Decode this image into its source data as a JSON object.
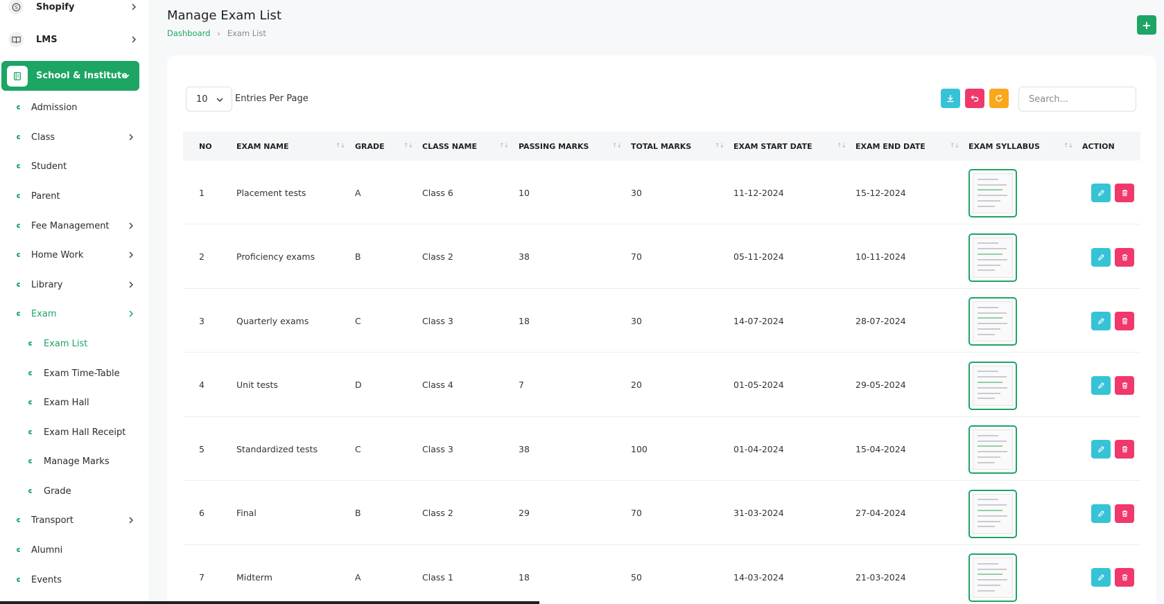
{
  "sidebar": {
    "top_items": [
      {
        "label": "Shopify",
        "icon": "shopify-icon"
      },
      {
        "label": "LMS",
        "icon": "book-icon"
      }
    ],
    "active_item": {
      "label": "School & Institute",
      "icon": "school-icon"
    },
    "items": [
      {
        "label": "Admission"
      },
      {
        "label": "Class"
      },
      {
        "label": "Student"
      },
      {
        "label": "Parent"
      },
      {
        "label": "Fee Management"
      },
      {
        "label": "Home Work"
      },
      {
        "label": "Library"
      },
      {
        "label": "Exam"
      }
    ],
    "exam_subitems": [
      {
        "label": "Exam List"
      },
      {
        "label": "Exam Time-Table"
      },
      {
        "label": "Exam Hall"
      },
      {
        "label": "Exam Hall Receipt"
      },
      {
        "label": "Manage Marks"
      },
      {
        "label": "Grade"
      }
    ],
    "bottom_items": [
      {
        "label": "Transport"
      },
      {
        "label": "Alumni"
      },
      {
        "label": "Events"
      }
    ]
  },
  "header": {
    "title": "Manage Exam List",
    "breadcrumb": [
      "Dashboard",
      "Exam List"
    ],
    "add_label": "+"
  },
  "toolbar": {
    "entries_value": "10",
    "entries_label": "Entries Per Page",
    "search_placeholder": "Search...",
    "colors": {
      "download": "#37c3d6",
      "reset": "#f0386b",
      "refresh": "#f9a71b"
    }
  },
  "table": {
    "columns": [
      "NO",
      "EXAM NAME",
      "GRADE",
      "CLASS NAME",
      "PASSING MARKS",
      "TOTAL MARKS",
      "EXAM START DATE",
      "EXAM END DATE",
      "EXAM SYLLABUS",
      "ACTION"
    ],
    "rows": [
      {
        "no": "1",
        "name": "Placement tests",
        "grade": "A",
        "class": "Class 6",
        "passing": "10",
        "total": "30",
        "start": "11-12-2024",
        "end": "15-12-2024"
      },
      {
        "no": "2",
        "name": "Proficiency exams",
        "grade": "B",
        "class": "Class 2",
        "passing": "38",
        "total": "70",
        "start": "05-11-2024",
        "end": "10-11-2024"
      },
      {
        "no": "3",
        "name": "Quarterly exams",
        "grade": "C",
        "class": "Class 3",
        "passing": "18",
        "total": "30",
        "start": "14-07-2024",
        "end": "28-07-2024"
      },
      {
        "no": "4",
        "name": "Unit tests",
        "grade": "D",
        "class": "Class 4",
        "passing": "7",
        "total": "20",
        "start": "01-05-2024",
        "end": "29-05-2024"
      },
      {
        "no": "5",
        "name": "Standardized tests",
        "grade": "C",
        "class": "Class 3",
        "passing": "38",
        "total": "100",
        "start": "01-04-2024",
        "end": "15-04-2024"
      },
      {
        "no": "6",
        "name": "Final",
        "grade": "B",
        "class": "Class 2",
        "passing": "29",
        "total": "70",
        "start": "31-03-2024",
        "end": "27-04-2024"
      },
      {
        "no": "7",
        "name": "Midterm",
        "grade": "A",
        "class": "Class 1",
        "passing": "18",
        "total": "50",
        "start": "14-03-2024",
        "end": "21-03-2024"
      }
    ]
  },
  "colors": {
    "accent": "#1ca563",
    "edit": "#37c3d6",
    "delete": "#f0386b"
  }
}
